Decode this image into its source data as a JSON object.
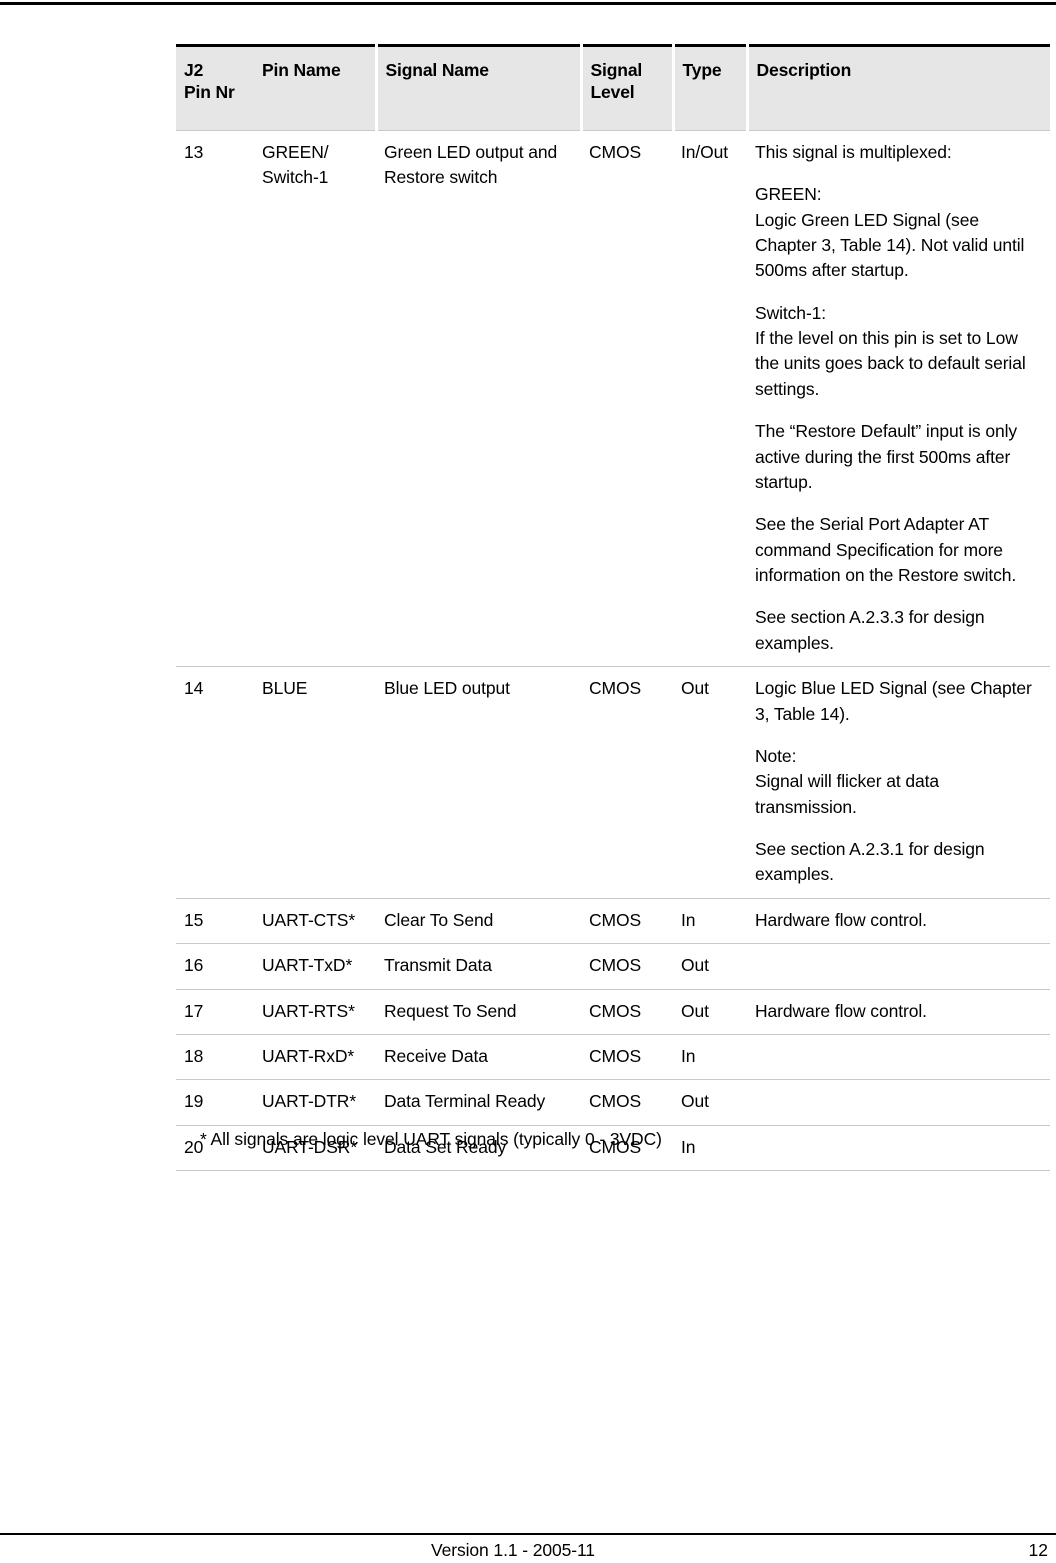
{
  "page": {
    "footer": {
      "version_label": "Version 1.1 - 2005-11",
      "page_number": "12"
    },
    "footnote": "* All signals are logic level UART signals (typically 0 - 3VDC)"
  },
  "table": {
    "columns": [
      {
        "key": "pin_nr",
        "header_line1": "J2",
        "header_line2": "Pin Nr"
      },
      {
        "key": "pin_name",
        "header_line1": "Pin Name",
        "header_line2": ""
      },
      {
        "key": "signal_name",
        "header_line1": "Signal Name",
        "header_line2": ""
      },
      {
        "key": "signal_level",
        "header_line1": "Signal",
        "header_line2": "Level"
      },
      {
        "key": "type",
        "header_line1": "Type",
        "header_line2": ""
      },
      {
        "key": "description",
        "header_line1": "Description",
        "header_line2": ""
      }
    ],
    "rows": [
      {
        "pin_nr": "13",
        "pin_name_lines": [
          "GREEN/",
          "Switch-1"
        ],
        "signal_name_lines": [
          "Green LED output and",
          "Restore switch"
        ],
        "signal_level": "CMOS",
        "type": "In/Out",
        "description_paragraphs": [
          [
            "This signal is multiplexed:"
          ],
          [
            "GREEN:",
            "Logic Green LED Signal (see Chapter 3, Table 14). Not valid until 500ms after startup."
          ],
          [
            "Switch-1:",
            "If the level on this pin is set to Low the units goes back to default serial settings."
          ],
          [
            "The “Restore Default” input is only active during the first 500ms after startup."
          ],
          [
            "See the Serial Port Adapter AT command Specification for more information on the Restore switch."
          ],
          [
            "See section A.2.3.3 for design examples."
          ]
        ]
      },
      {
        "pin_nr": "14",
        "pin_name_lines": [
          "BLUE"
        ],
        "signal_name_lines": [
          "Blue LED output"
        ],
        "signal_level": "CMOS",
        "type": "Out",
        "description_paragraphs": [
          [
            "Logic Blue LED Signal (see Chapter 3, Table 14)."
          ],
          [
            "Note:",
            "Signal will flicker at data transmission."
          ],
          [
            "See section A.2.3.1 for design examples."
          ]
        ]
      },
      {
        "pin_nr": "15",
        "pin_name_lines": [
          "UART-CTS*"
        ],
        "signal_name_lines": [
          "Clear To Send"
        ],
        "signal_level": "CMOS",
        "type": "In",
        "description_paragraphs": [
          [
            "Hardware flow control."
          ]
        ]
      },
      {
        "pin_nr": "16",
        "pin_name_lines": [
          "UART-TxD*"
        ],
        "signal_name_lines": [
          "Transmit Data"
        ],
        "signal_level": "CMOS",
        "type": "Out",
        "description_paragraphs": [
          [
            ""
          ]
        ]
      },
      {
        "pin_nr": "17",
        "pin_name_lines": [
          "UART-RTS*"
        ],
        "signal_name_lines": [
          "Request To Send"
        ],
        "signal_level": "CMOS",
        "type": "Out",
        "description_paragraphs": [
          [
            "Hardware flow control."
          ]
        ]
      },
      {
        "pin_nr": "18",
        "pin_name_lines": [
          "UART-RxD*"
        ],
        "signal_name_lines": [
          "Receive Data"
        ],
        "signal_level": "CMOS",
        "type": "In",
        "description_paragraphs": [
          [
            ""
          ]
        ]
      },
      {
        "pin_nr": "19",
        "pin_name_lines": [
          "UART-DTR*"
        ],
        "signal_name_lines": [
          "Data Terminal Ready"
        ],
        "signal_level": "CMOS",
        "type": "Out",
        "description_paragraphs": [
          [
            ""
          ]
        ]
      },
      {
        "pin_nr": "20",
        "pin_name_lines": [
          "UART-DSR*"
        ],
        "signal_name_lines": [
          "Data Set Ready"
        ],
        "signal_level": "CMOS",
        "type": "In",
        "description_paragraphs": [
          [
            ""
          ]
        ]
      }
    ]
  },
  "colors": {
    "header_background": "#e6e6e6",
    "rule": "#000000",
    "row_separator": "#c9c9c9",
    "text": "#000000"
  }
}
